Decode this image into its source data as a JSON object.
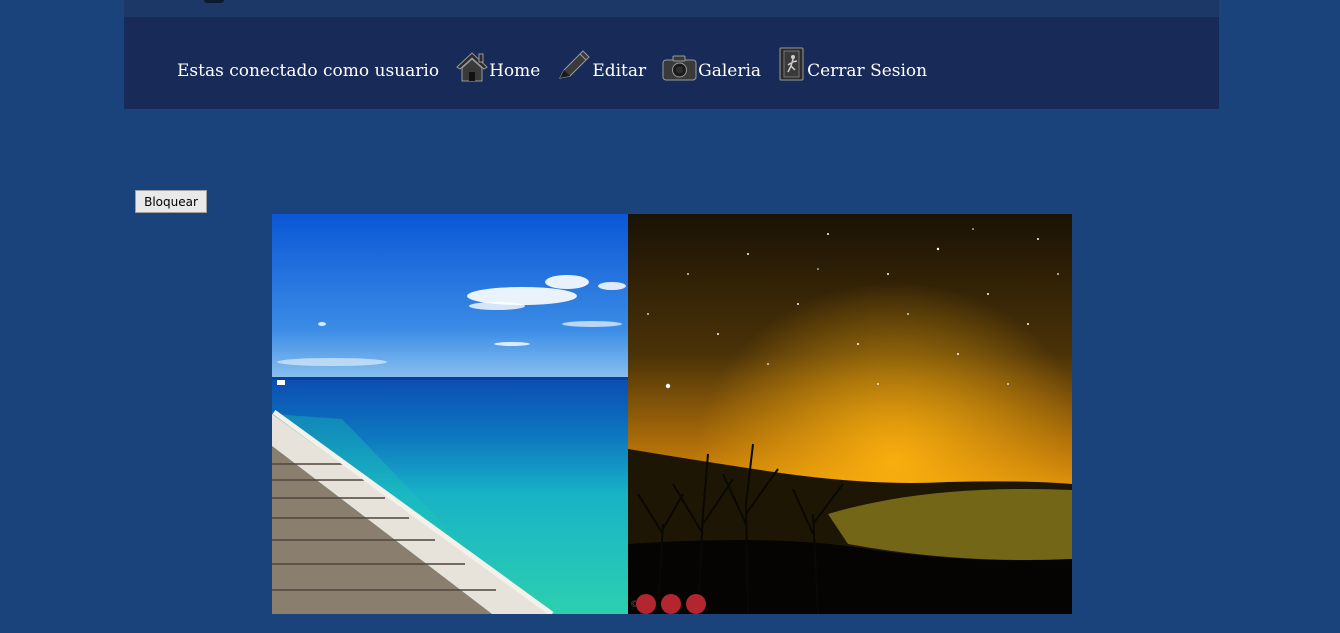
{
  "header": {
    "status_text": "Estas conectado como usuario",
    "nav": [
      {
        "label": "Home",
        "icon": "home-icon"
      },
      {
        "label": "Editar",
        "icon": "pencil-icon"
      },
      {
        "label": "Galeria",
        "icon": "camera-icon"
      },
      {
        "label": "Cerrar Sesion",
        "icon": "logout-door-icon"
      }
    ]
  },
  "main": {
    "lock_button": "Bloquear",
    "slider": {
      "slides": [
        {
          "name": "pier-ocean-photo"
        },
        {
          "name": "starry-night-sky-photo"
        }
      ],
      "dot_count": 3,
      "dot_color": "#b3262f",
      "credit": "©"
    }
  },
  "colors": {
    "background": "#1a427b",
    "navbar": "#182a57",
    "top_strip": "#1b3866"
  }
}
